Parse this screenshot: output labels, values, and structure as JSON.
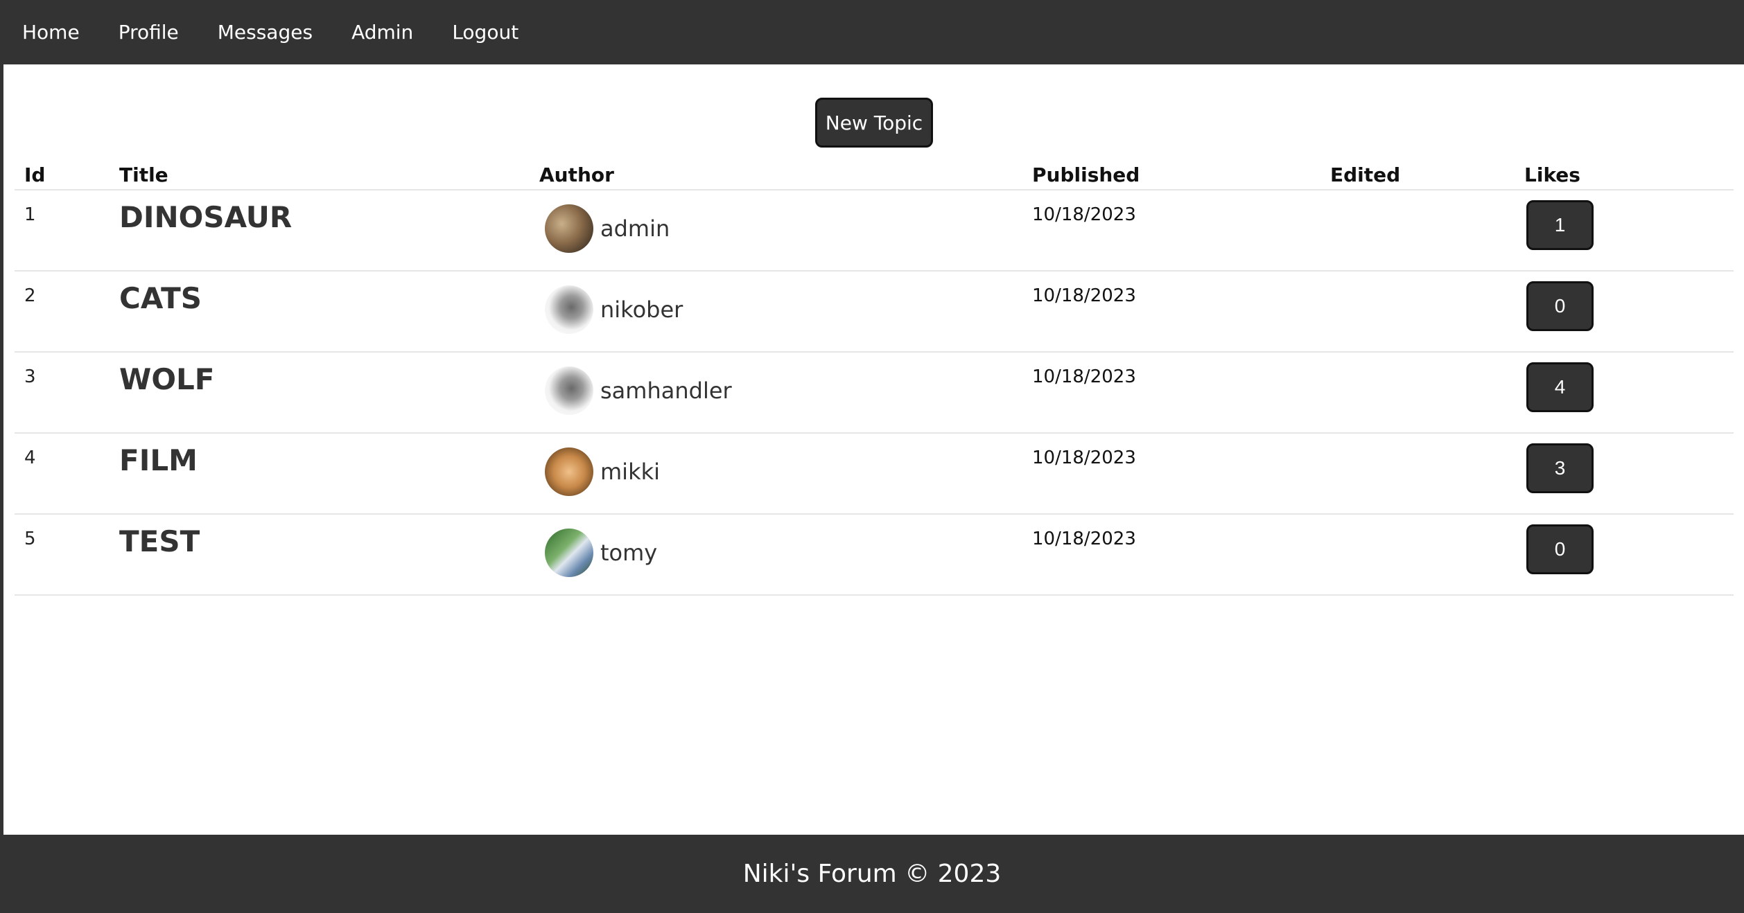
{
  "nav": {
    "items": [
      {
        "label": "Home"
      },
      {
        "label": "Profile"
      },
      {
        "label": "Messages"
      },
      {
        "label": "Admin"
      },
      {
        "label": "Logout"
      }
    ]
  },
  "main": {
    "new_topic_label": "New Topic"
  },
  "table": {
    "headers": {
      "id": "Id",
      "title": "Title",
      "author": "Author",
      "published": "Published",
      "edited": "Edited",
      "likes": "Likes"
    },
    "rows": [
      {
        "id": "1",
        "title": "DINOSAUR",
        "author": "admin",
        "avatar": "cat-avatar",
        "published": "10/18/2023",
        "edited": "",
        "likes": "1"
      },
      {
        "id": "2",
        "title": "CATS",
        "author": "nikober",
        "avatar": "cat-avatar",
        "published": "10/18/2023",
        "edited": "",
        "likes": "0"
      },
      {
        "id": "3",
        "title": "WOLF",
        "author": "samhandler",
        "avatar": "cat-avatar",
        "published": "10/18/2023",
        "edited": "",
        "likes": "4"
      },
      {
        "id": "4",
        "title": "FILM",
        "author": "mikki",
        "avatar": "cat-avatar",
        "published": "10/18/2023",
        "edited": "",
        "likes": "3"
      },
      {
        "id": "5",
        "title": "TEST",
        "author": "tomy",
        "avatar": "tiger-avatar",
        "published": "10/18/2023",
        "edited": "",
        "likes": "0"
      }
    ]
  },
  "footer": {
    "text": "Niki's Forum © 2023"
  },
  "colors": {
    "bar": "#333333",
    "background": "#ffffff",
    "button": "#333333",
    "button_text": "#ffffff"
  }
}
